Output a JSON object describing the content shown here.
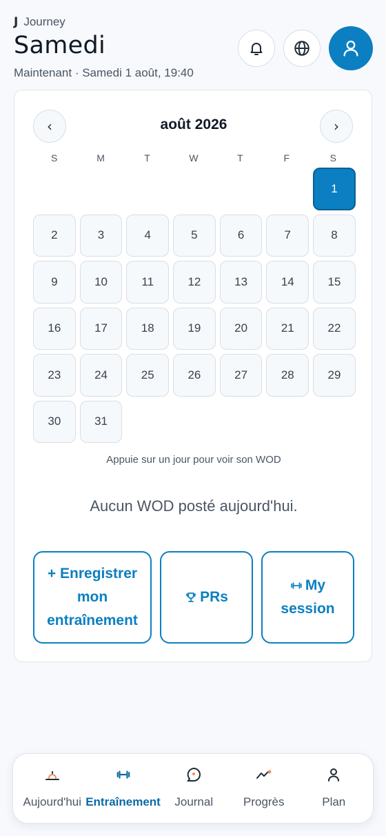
{
  "colors": {
    "accent": "#0b7fc1",
    "accent_dark": "#0a5f93",
    "text": "#1f2a37",
    "muted": "#4b5563",
    "orange": "#f08a5d"
  },
  "header": {
    "app_logo": "J",
    "app_name": "Journey",
    "title": "Samedi",
    "subtitle": "Maintenant · Samedi 1 août, 19:40",
    "icons": [
      "bell-icon",
      "globe-icon",
      "user-icon"
    ]
  },
  "calendar": {
    "prev_label": "‹",
    "next_label": "›",
    "month_title": "août 2026",
    "weekdays": [
      "S",
      "M",
      "T",
      "W",
      "T",
      "F",
      "S"
    ],
    "days": [
      "",
      "",
      "",
      "",
      "",
      "",
      "1",
      "2",
      "3",
      "4",
      "5",
      "6",
      "7",
      "8",
      "9",
      "10",
      "11",
      "12",
      "13",
      "14",
      "15",
      "16",
      "17",
      "18",
      "19",
      "20",
      "21",
      "22",
      "23",
      "24",
      "25",
      "26",
      "27",
      "28",
      "29",
      "30",
      "31"
    ],
    "selected_day": "1",
    "hint": "Appuie sur un jour pour voir son WOD"
  },
  "wod": {
    "empty_message": "Aucun WOD posté aujourd'hui."
  },
  "actions": {
    "log_workout": "+ Enregistrer mon entraînement",
    "prs": "PRs",
    "my_session": "My session"
  },
  "bottom_nav": {
    "active": "Entraînement",
    "items": [
      {
        "label": "Aujourd'hui",
        "icon": "sunrise-icon"
      },
      {
        "label": "Entraînement",
        "icon": "dumbbell-icon"
      },
      {
        "label": "Journal",
        "icon": "chat-bubble-icon"
      },
      {
        "label": "Progrès",
        "icon": "trend-icon"
      },
      {
        "label": "Plan",
        "icon": "user-icon"
      }
    ]
  }
}
